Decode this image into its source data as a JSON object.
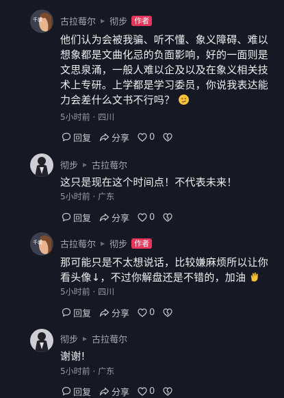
{
  "comments": [
    {
      "user": "古拉莓尔",
      "reply_to": "",
      "badge": "作者",
      "text": "他们认为会被我骗、听不懂、象义障碍、难以想象都是文曲化忌的负面影响，好的一面则是文思泉涌，一般人难以企及以及在象义相关技术上专研。上学都是学习委员，你说我表达能力会差什么文书不行吗？",
      "emoji": "smirk-emoji",
      "time": "5小时前",
      "location": "四川",
      "reply_label": "回复",
      "share_label": "分享",
      "likes": "0"
    },
    {
      "user": "彻步",
      "reply_to": "古拉莓尔",
      "badge": "",
      "text": "这只是现在这个时间点！不代表未来！",
      "emoji": "",
      "time": "5小时前",
      "location": "广东",
      "reply_label": "回复",
      "share_label": "分享",
      "likes": "0"
    },
    {
      "user": "古拉莓尔",
      "reply_to": "彻步",
      "badge": "作者",
      "text": "那可能只是不太想说话，比较嫌麻烦所以让你看头像↓，不过你解盘还是不错的，加油",
      "emoji": "clap-emoji",
      "time": "5小时前",
      "location": "四川",
      "reply_label": "回复",
      "share_label": "分享",
      "likes": "0"
    },
    {
      "user": "彻步",
      "reply_to": "古拉莓尔",
      "badge": "",
      "text": "谢谢!",
      "emoji": "",
      "time": "5小时前",
      "location": "广东",
      "reply_label": "回复",
      "share_label": "分享",
      "likes": "0"
    }
  ],
  "meta_separator": " · ",
  "avatar_text": "千叔"
}
